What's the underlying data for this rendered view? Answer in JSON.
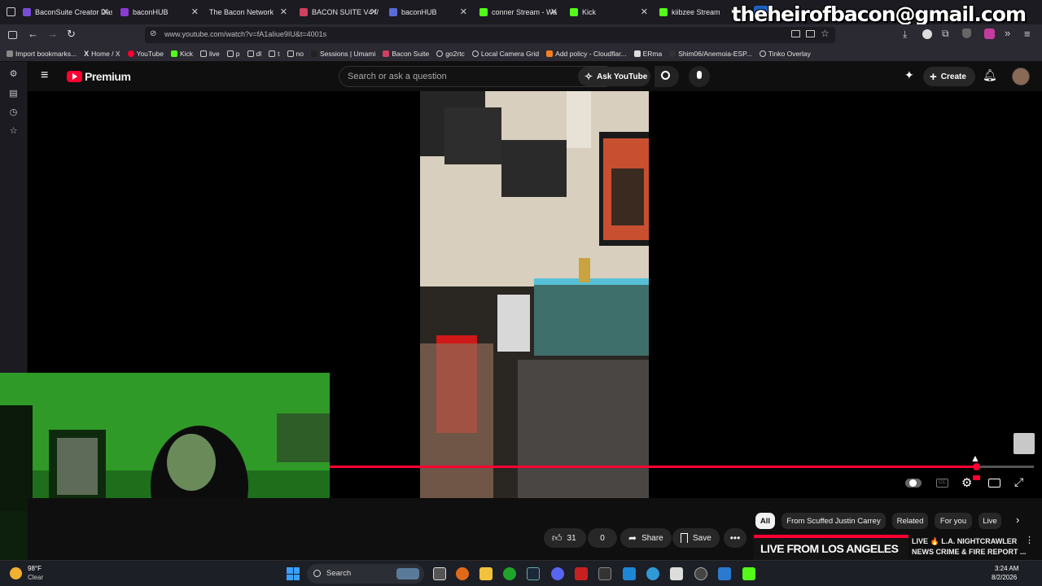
{
  "tabs": [
    {
      "label": "BaconSuite Creator Dash",
      "color": "#7a4dd8"
    },
    {
      "label": "baconHUB",
      "color": "#8a3bd1"
    },
    {
      "label": "The Bacon Network",
      "color": "#444444"
    },
    {
      "label": "BACON SUITE V4 //",
      "color": "#d04060"
    },
    {
      "label": "baconHUB",
      "color": "#5a6bd8"
    },
    {
      "label": "conner Stream - Wa",
      "color": "#53fc18"
    },
    {
      "label": "Kick",
      "color": "#53fc18"
    },
    {
      "label": "kiibzee Stream",
      "color": "#53fc18"
    }
  ],
  "overlay_email": "theheirofbacon@gmail.com",
  "url": "www.youtube.com/watch?v=fA1aIiue9IU&t=4001s",
  "bookmarks": [
    "Import bookmarks...",
    "Home / X",
    "YouTube",
    "Kick",
    "live",
    "p",
    "dl",
    "t",
    "no",
    "Sessions | Umami",
    "Bacon Suite",
    "go2rtc",
    "Local Camera Grid",
    "Add policy - Cloudflar...",
    "ERma",
    "Shim06/Anemoia-ESP...",
    "Tinko Overlay"
  ],
  "youtube": {
    "logo": "Premium",
    "search_placeholder": "Search or ask a question",
    "ask_label": "Ask YouTube",
    "create_label": "Create"
  },
  "actions": {
    "likes": "31",
    "dislikes": "0",
    "share": "Share",
    "save": "Save"
  },
  "chips": [
    "All",
    "From Scuffed Justin Carrey",
    "Related",
    "For you",
    "Live"
  ],
  "recommendation": {
    "thumb_text": "LIVE FROM LOS ANGELES",
    "title_line1": "LIVE 🔥 L.A. NIGHTCRAWLER",
    "title_line2": "NEWS CRIME & FIRE REPORT ..."
  },
  "video_progress_percent": 92,
  "taskbar": {
    "weather_temp": "98°F",
    "weather_desc": "Clear",
    "search": "Search",
    "time": "3:24 AM",
    "date": "8/2/2026"
  }
}
